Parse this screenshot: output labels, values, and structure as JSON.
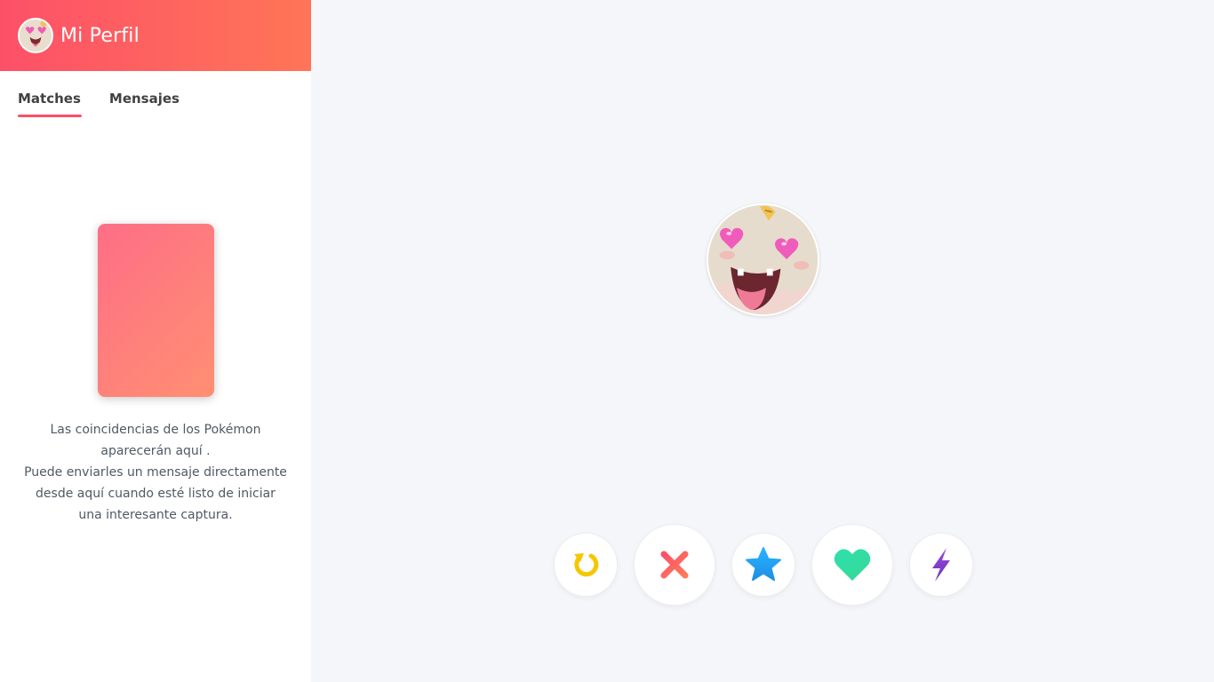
{
  "header": {
    "title": "Mi Perfil",
    "gradient": [
      "#fd5068",
      "#ff7557"
    ]
  },
  "tabs": [
    {
      "label": "Matches",
      "active": true
    },
    {
      "label": "Mensajes",
      "active": false
    }
  ],
  "empty_state": {
    "line1": "Las coincidencias de los Pokémon",
    "line2": "aparecerán aquí .",
    "line3": "Puede enviarles un mensaje directamente",
    "line4": "desde aquí cuando esté listo de iniciar",
    "line5": "una interesante captura."
  },
  "actions": [
    {
      "name": "rewind",
      "icon": "rewind-icon",
      "color": "#f5c700"
    },
    {
      "name": "nope",
      "icon": "close-icon",
      "color": "#fd5068"
    },
    {
      "name": "super-like",
      "icon": "star-icon",
      "color": "#1fa6f0"
    },
    {
      "name": "like",
      "icon": "heart-icon",
      "color": "#2be3a4"
    },
    {
      "name": "boost",
      "icon": "lightning-icon",
      "color": "#7a3bc7"
    }
  ],
  "colors": {
    "accent": "#fd5068",
    "background": "#f5f6fa",
    "text": "#424242"
  }
}
